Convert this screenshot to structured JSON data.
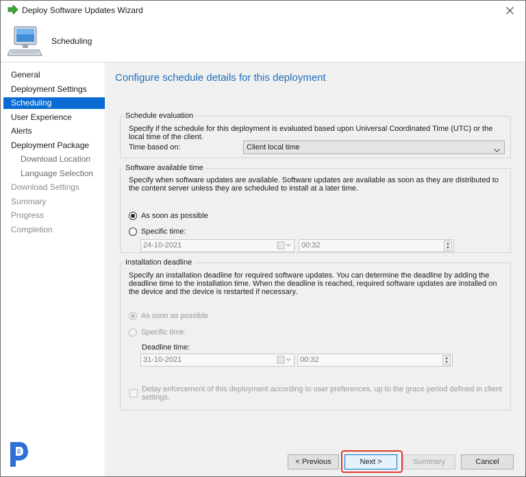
{
  "window": {
    "title": "Deploy Software Updates Wizard"
  },
  "header": {
    "title": "Scheduling",
    "icon": "computer-icon"
  },
  "sidebar": {
    "items": [
      {
        "label": "General",
        "state": "normal"
      },
      {
        "label": "Deployment Settings",
        "state": "normal"
      },
      {
        "label": "Scheduling",
        "state": "selected"
      },
      {
        "label": "User Experience",
        "state": "normal"
      },
      {
        "label": "Alerts",
        "state": "normal"
      },
      {
        "label": "Deployment Package",
        "state": "normal"
      },
      {
        "label": "Download Location",
        "state": "sub"
      },
      {
        "label": "Language Selection",
        "state": "sub"
      },
      {
        "label": "Download Settings",
        "state": "disabled"
      },
      {
        "label": "Summary",
        "state": "disabled"
      },
      {
        "label": "Progress",
        "state": "disabled"
      },
      {
        "label": "Completion",
        "state": "disabled"
      }
    ]
  },
  "main": {
    "heading": "Configure schedule details for this deployment",
    "schedule_evaluation": {
      "legend": "Schedule evaluation",
      "description": "Specify if the schedule for this deployment is evaluated based upon Universal Coordinated Time (UTC) or the local time of the client.",
      "time_based_on_label": "Time based on:",
      "time_based_on_value": "Client local time"
    },
    "software_available": {
      "legend": "Software available time",
      "description": "Specify when software updates are available. Software updates are available as soon as they are distributed to the content server unless they are scheduled to install at a later time.",
      "option_asap": "As soon as possible",
      "option_specific": "Specific time:",
      "selected": "asap",
      "date": "24-10-2021",
      "time": "00:32"
    },
    "installation_deadline": {
      "legend": "Installation deadline",
      "description": "Specify an installation deadline for required software updates. You can determine the deadline by adding the deadline time to the installation time. When the deadline is reached, required software updates are installed on the device and the device is restarted if necessary.",
      "option_asap": "As soon as possible",
      "option_specific": "Specific time:",
      "deadline_label": "Deadline time:",
      "date": "31-10-2021",
      "time": "00:32",
      "delay_label": "Delay enforcement of this deployment according to user preferences, up to the grace period defined in client settings."
    }
  },
  "footer": {
    "previous": "< Previous",
    "next": "Next >",
    "summary": "Summary",
    "cancel": "Cancel"
  },
  "colors": {
    "selected_nav": "#0a6cd2",
    "heading": "#1f6fb8",
    "highlight": "#e0392e"
  }
}
